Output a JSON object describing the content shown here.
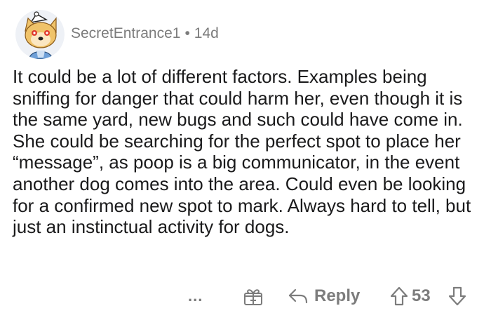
{
  "comment": {
    "username": "SecretEntrance1",
    "separator": "•",
    "age": "14d",
    "body": "It could be a lot of different factors. Examples being sniffing for danger that could harm her, even though it is the same yard, new bugs and such could have come in. She could be searching for the perfect spot to place her “message”, as poop is a big communicator, in the event another dog comes into the area. Could even be looking for a confirmed new spot to mark. Always hard to tell, but just an instinctual activity for dogs."
  },
  "actions": {
    "more": "...",
    "reply_label": "Reply",
    "score": "53"
  },
  "icons": {
    "avatar": "doge-snoo-avatar",
    "more": "more-dots-icon",
    "award": "award-gift-icon",
    "reply": "reply-arrow-icon",
    "upvote": "upvote-arrow-icon",
    "downvote": "downvote-arrow-icon"
  }
}
